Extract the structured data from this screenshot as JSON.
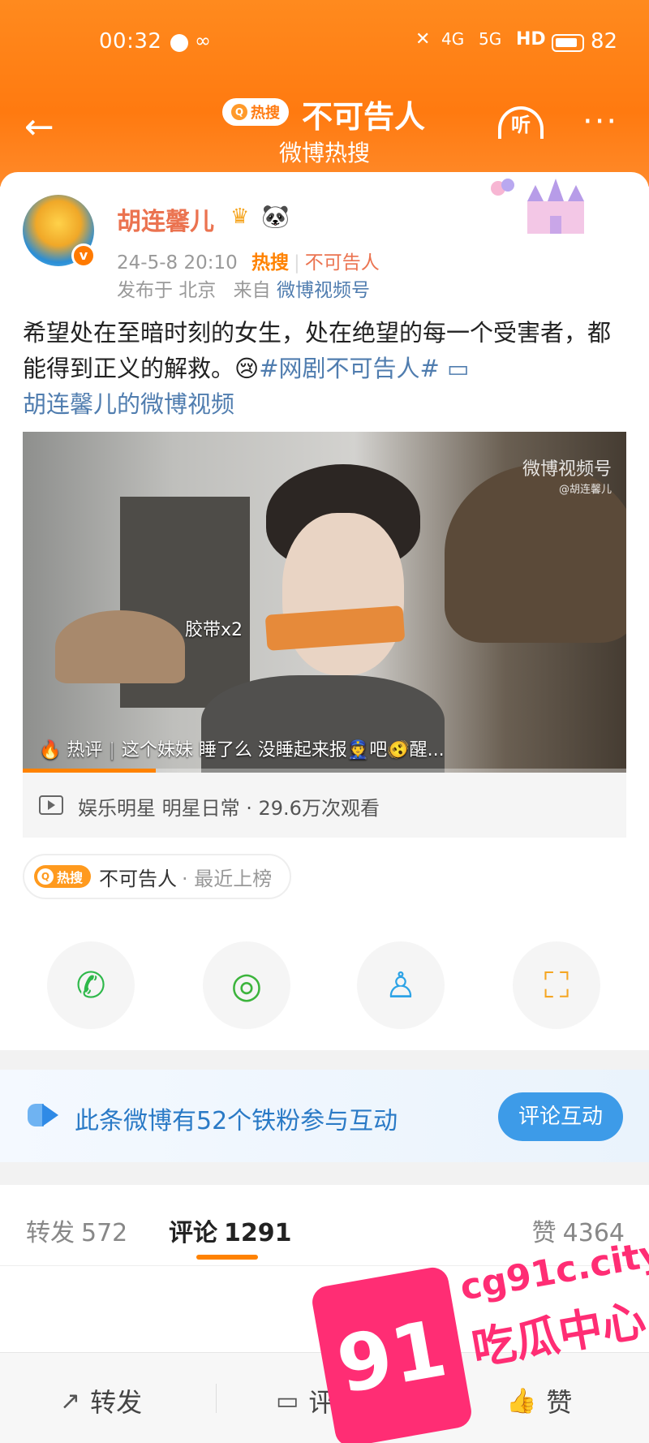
{
  "status_bar": {
    "time": "00:32",
    "network1": "4G",
    "network2": "5G",
    "hd": "HD",
    "battery": "82"
  },
  "header": {
    "hot_badge": "热搜",
    "title": "不可告人",
    "subtitle": "微博热搜",
    "listen_label": "听"
  },
  "post": {
    "username": "胡连馨儿",
    "datetime": "24-5-8 20:10",
    "hot_label": "热搜",
    "hot_topic": "不可告人",
    "location": "发布于 北京",
    "from_prefix": "来自",
    "source": "微博视频号",
    "text": "希望处在至暗时刻的女生，处在绝望的每一个受害者，都能得到正义的解救。",
    "hashtag": "#网剧不可告人#",
    "video_link": "胡连馨儿的微博视频",
    "emoji": "😢"
  },
  "video": {
    "watermark": "微博视频号",
    "watermark_user": "@胡连馨儿",
    "overlay_label": "胶带x2",
    "hot_comment_label": "热评",
    "hot_comment": "这个妹妹 睡了么 没睡起来报👮吧🫨醒...",
    "progress": 0.22
  },
  "video_info": {
    "text": "娱乐明星 明星日常 · 29.6万次观看"
  },
  "hot_chip": {
    "badge": "热搜",
    "topic": "不可告人",
    "status": "· 最近上榜"
  },
  "share_icons": [
    "wechat-icon",
    "moments-icon",
    "qq-icon",
    "save-image-icon"
  ],
  "fans_banner": {
    "text": "此条微博有52个铁粉参与互动",
    "button": "评论互动"
  },
  "tabs": {
    "repost_label": "转发",
    "repost_count": "572",
    "comment_label": "评论",
    "comment_count": "1291",
    "like_label": "赞",
    "like_count": "4364"
  },
  "bottom_bar": {
    "repost": "转发",
    "comment": "评论",
    "like": "赞"
  },
  "watermark": {
    "number": "91",
    "site": "cg91c.city",
    "name": "吃瓜中心"
  },
  "colors": {
    "accent": "#ff8200",
    "link": "#507daf",
    "username": "#eb7350",
    "button": "#3d9be8"
  }
}
